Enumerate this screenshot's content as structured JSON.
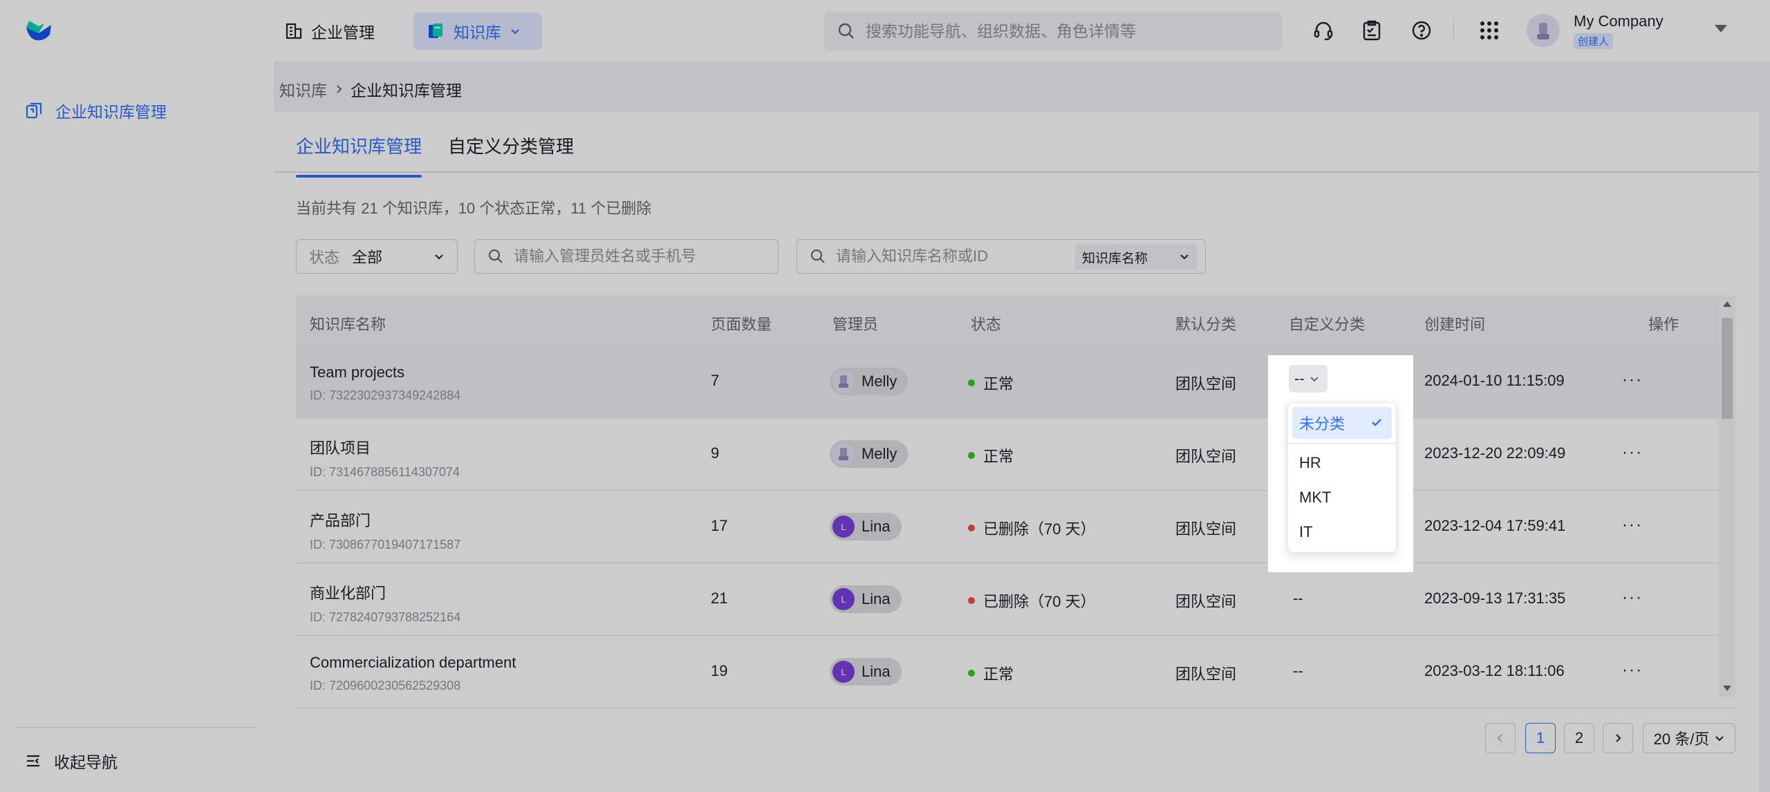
{
  "topbar": {
    "corp_label": "企业管理",
    "kb_label": "知识库",
    "search_placeholder": "搜索功能导航、组织数据、角色详情等",
    "company_name": "My Company",
    "company_role": "创建人"
  },
  "sidebar": {
    "item_label": "企业知识库管理",
    "collapse_label": "收起导航"
  },
  "breadcrumb": {
    "root": "知识库",
    "current": "企业知识库管理"
  },
  "tabs": [
    {
      "label": "企业知识库管理",
      "active": true
    },
    {
      "label": "自定义分类管理",
      "active": false
    }
  ],
  "summary": "当前共有 21 个知识库，10 个状态正常，11 个已删除",
  "filters": {
    "status_label": "状态",
    "status_value": "全部",
    "admin_placeholder": "请输入管理员姓名或手机号",
    "kb_placeholder": "请输入知识库名称或ID",
    "kb_type": "知识库名称"
  },
  "table": {
    "headers": [
      "知识库名称",
      "页面数量",
      "管理员",
      "状态",
      "默认分类",
      "自定义分类",
      "创建时间",
      "操作"
    ],
    "rows": [
      {
        "name": "Team projects",
        "id": "ID: 7322302937349242884",
        "pages": "7",
        "admin": "Melly",
        "admin_initial": "",
        "status": "正常",
        "status_type": "ok",
        "default_cat": "团队空间",
        "custom_cat": "--",
        "created": "2024-01-10 11:15:09"
      },
      {
        "name": "团队项目",
        "id": "ID: 7314678856114307074",
        "pages": "9",
        "admin": "Melly",
        "admin_initial": "",
        "status": "正常",
        "status_type": "ok",
        "default_cat": "团队空间",
        "custom_cat": "",
        "created": "2023-12-20 22:09:49"
      },
      {
        "name": "产品部门",
        "id": "ID: 7308677019407171587",
        "pages": "17",
        "admin": "Lina",
        "admin_initial": "L",
        "status": "已删除（70 天）",
        "status_type": "del",
        "default_cat": "团队空间",
        "custom_cat": "",
        "created": "2023-12-04 17:59:41"
      },
      {
        "name": "商业化部门",
        "id": "ID: 7278240793788252164",
        "pages": "21",
        "admin": "Lina",
        "admin_initial": "L",
        "status": "已删除（70 天）",
        "status_type": "del",
        "default_cat": "团队空间",
        "custom_cat": "--",
        "created": "2023-09-13 17:31:35"
      },
      {
        "name": "Commercialization department",
        "id": "ID: 7209600230562529308",
        "pages": "19",
        "admin": "Lina",
        "admin_initial": "L",
        "status": "正常",
        "status_type": "ok",
        "default_cat": "团队空间",
        "custom_cat": "--",
        "created": "2023-03-12 18:11:06"
      }
    ],
    "more_label": "···"
  },
  "category_dropdown": {
    "trigger_value": "--",
    "options": [
      {
        "label": "未分类",
        "selected": true
      },
      {
        "label": "HR",
        "selected": false
      },
      {
        "label": "MKT",
        "selected": false
      },
      {
        "label": "IT",
        "selected": false
      }
    ]
  },
  "pagination": {
    "pages": [
      "1",
      "2"
    ],
    "current": "1",
    "page_size": "20 条/页"
  },
  "colors": {
    "accent": "#3370ff",
    "status_ok": "#34c724",
    "status_deleted": "#f54a45"
  }
}
